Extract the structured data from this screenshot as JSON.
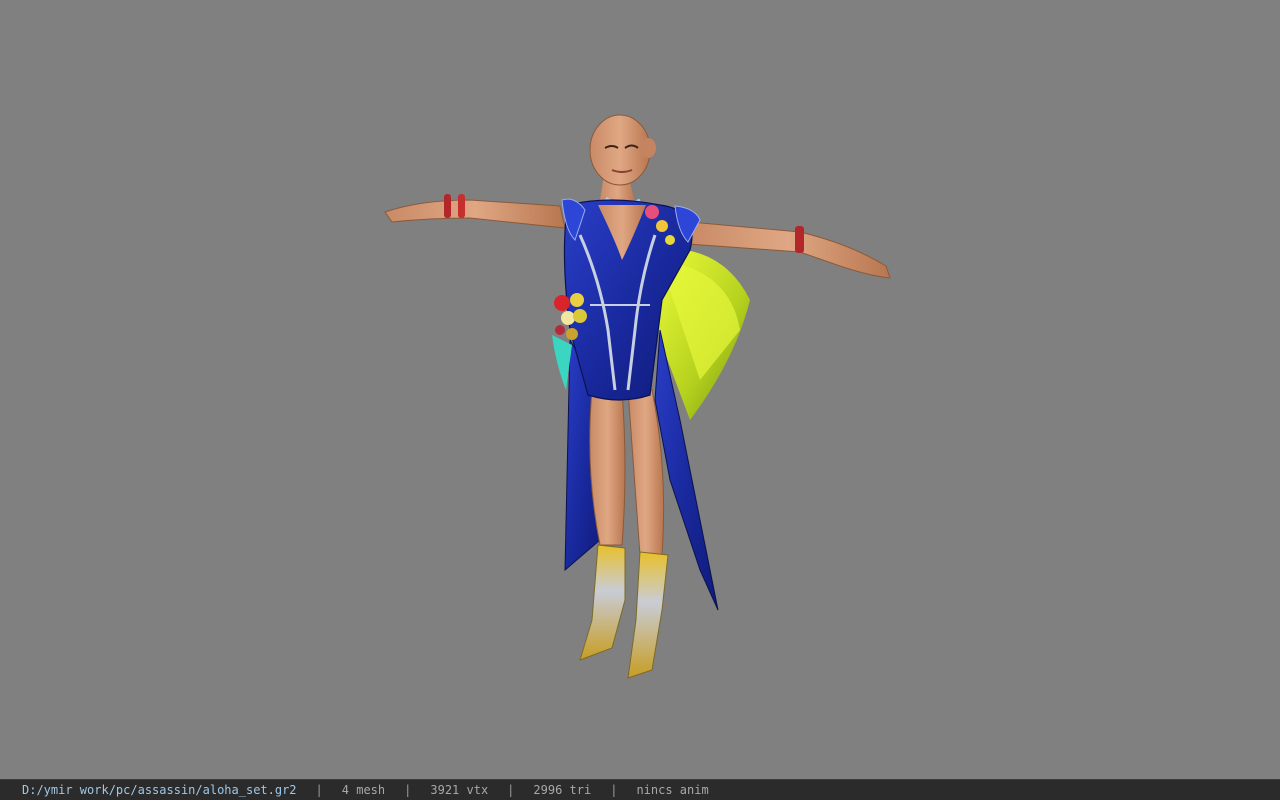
{
  "status_bar": {
    "file_path": "D:/ymir work/pc/assassin/aloha_set.gr2",
    "separator": "|",
    "mesh_count": "4 mesh",
    "vertex_count": "3921 vtx",
    "triangle_count": "2996 tri",
    "animation": "nincs anim"
  },
  "colors": {
    "viewport_background": "#808080",
    "status_bar_background": "#2b2b2b",
    "path_text": "#9fc7e6",
    "stat_text": "#a8a8a8"
  }
}
